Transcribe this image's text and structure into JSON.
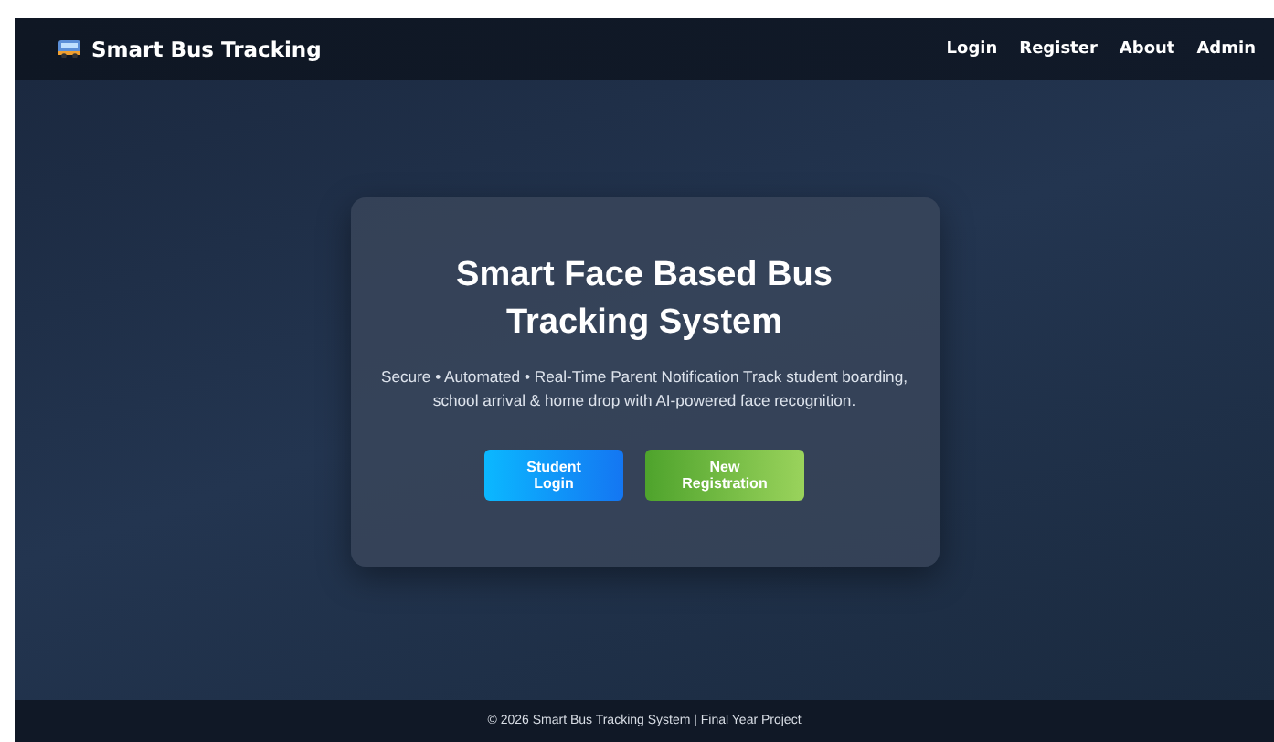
{
  "navbar": {
    "brand": "Smart Bus Tracking",
    "links": [
      "Login",
      "Register",
      "About",
      "Admin"
    ]
  },
  "hero": {
    "title": "Smart Face Based Bus Tracking System",
    "subtitle": "Secure • Automated • Real-Time Parent Notification Track student boarding, school arrival & home drop with AI-powered face recognition.",
    "buttons": [
      {
        "label": "Student Login",
        "kind": "primary"
      },
      {
        "label": "New Registration",
        "kind": "success"
      }
    ]
  },
  "footer": {
    "text": "© 2026 Smart Bus Tracking System | Final Year Project"
  }
}
